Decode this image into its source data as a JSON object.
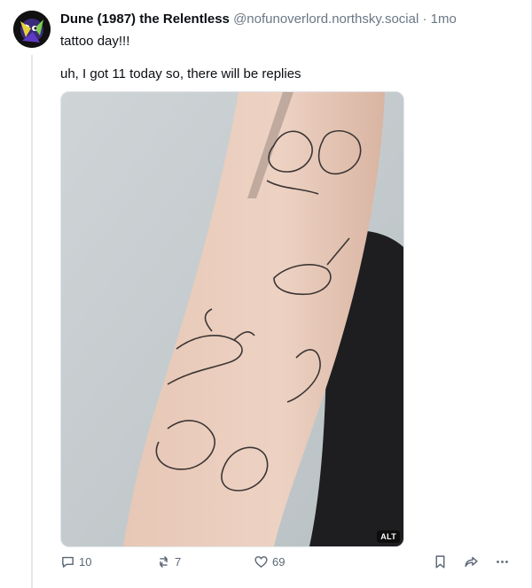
{
  "post": {
    "display_name": "Dune (1987) the Relentless",
    "handle": "@nofunoverlord.northsky.social",
    "separator": "·",
    "time": "1mo",
    "text_line1": "tattoo day!!!",
    "text_line2": "uh, I got 11 today so, there will be replies",
    "image_alt_badge": "ALT",
    "counts": {
      "replies": "10",
      "reposts": "7",
      "likes": "69"
    }
  },
  "icons": {
    "reply": "speech-bubble-icon",
    "repost": "repost-arrows-icon",
    "like": "heart-icon",
    "bookmark": "bookmark-icon",
    "share": "share-arrow-icon",
    "more": "ellipsis-icon"
  },
  "colors": {
    "text": "#0b0f14",
    "muted": "#6b7785",
    "icon": "#5b6775",
    "border": "#e3e8ee"
  }
}
